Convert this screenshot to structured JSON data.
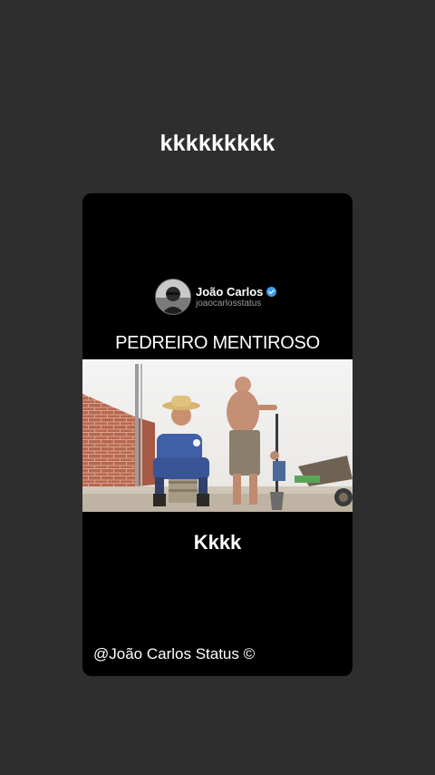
{
  "story": {
    "caption": "kkkkkkkkk"
  },
  "post": {
    "profile_name": "João Carlos",
    "profile_handle": "joaocarlosstatus",
    "verified": true,
    "headline": "PEDREIRO MENTIROSO",
    "subcaption": "Kkkk",
    "watermark": "@João Carlos Status ©"
  },
  "colors": {
    "background": "#2f2e2e",
    "card": "#000000",
    "text": "#ffffff",
    "verified_badge": "#3b9cf0",
    "handle": "#9a9a9a"
  }
}
